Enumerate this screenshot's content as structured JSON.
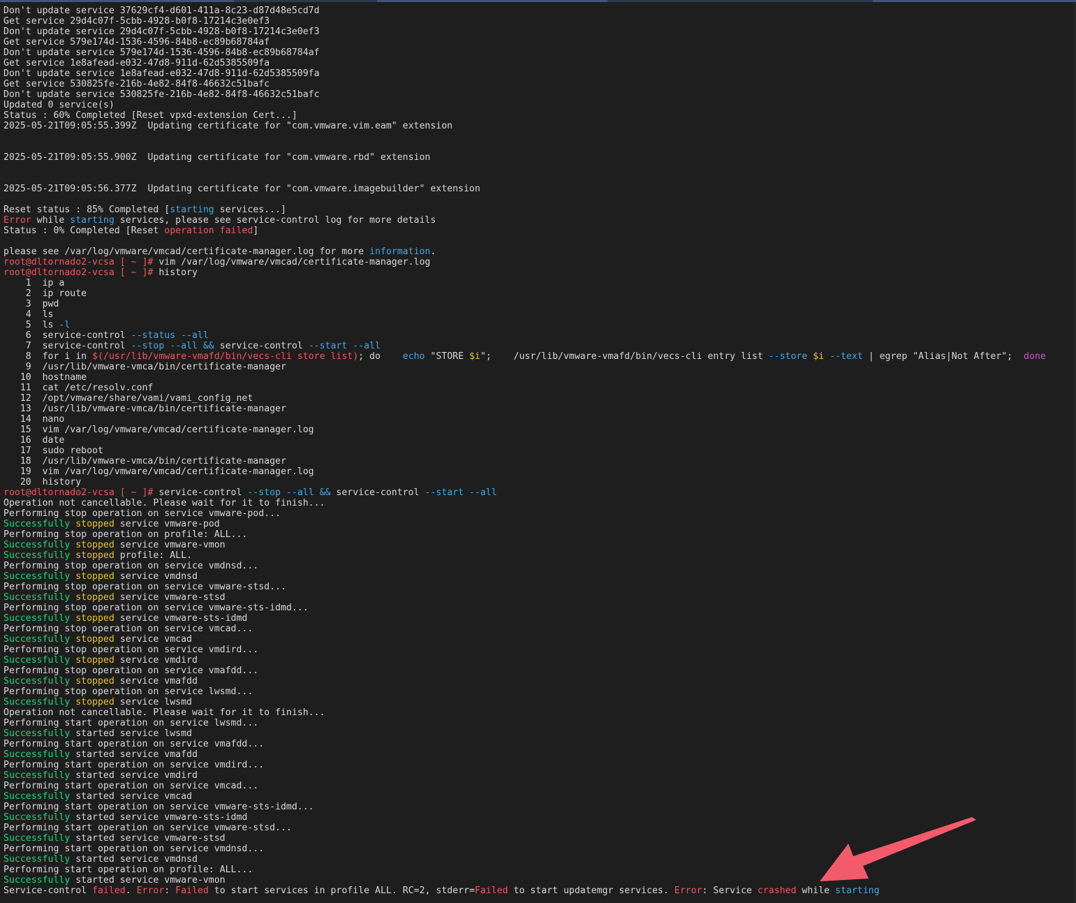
{
  "terminal": {
    "lines": [
      [
        {
          "t": "Don't update service 37629cf4-d601-411a-8c23-d87d48e5cd7d",
          "c": "normal"
        }
      ],
      [
        {
          "t": "Get service 29d4c07f-5cbb-4928-b0f8-17214c3e0ef3",
          "c": "normal"
        }
      ],
      [
        {
          "t": "Don't update service 29d4c07f-5cbb-4928-b0f8-17214c3e0ef3",
          "c": "normal"
        }
      ],
      [
        {
          "t": "Get service 579e174d-1536-4596-84b8-ec89b68784af",
          "c": "normal"
        }
      ],
      [
        {
          "t": "Don't update service 579e174d-1536-4596-84b8-ec89b68784af",
          "c": "normal"
        }
      ],
      [
        {
          "t": "Get service 1e8afead-e032-47d8-911d-62d5385509fa",
          "c": "normal"
        }
      ],
      [
        {
          "t": "Don't update service 1e8afead-e032-47d8-911d-62d5385509fa",
          "c": "normal"
        }
      ],
      [
        {
          "t": "Get service 530825fe-216b-4e82-84f8-46632c51bafc",
          "c": "normal"
        }
      ],
      [
        {
          "t": "Don't update service 530825fe-216b-4e82-84f8-46632c51bafc",
          "c": "normal"
        }
      ],
      [
        {
          "t": "Updated 0 service(s)",
          "c": "normal"
        }
      ],
      [
        {
          "t": "Status : 60% Completed [Reset vpxd-extension Cert...]",
          "c": "normal"
        }
      ],
      [
        {
          "t": "2025-05-21T09:05:55.399Z  Updating certificate for \"com.vmware.vim.eam\" extension",
          "c": "normal"
        }
      ],
      [],
      [],
      [
        {
          "t": "2025-05-21T09:05:55.900Z  Updating certificate for \"com.vmware.rbd\" extension",
          "c": "normal"
        }
      ],
      [],
      [],
      [
        {
          "t": "2025-05-21T09:05:56.377Z  Updating certificate for \"com.vmware.imagebuilder\" extension",
          "c": "normal"
        }
      ],
      [],
      [
        {
          "t": "Reset status : 85% Completed [",
          "c": "normal"
        },
        {
          "t": "starting",
          "c": "cyan"
        },
        {
          "t": " services...]",
          "c": "normal"
        }
      ],
      [
        {
          "t": "Error",
          "c": "red"
        },
        {
          "t": " while ",
          "c": "normal"
        },
        {
          "t": "starting",
          "c": "cyan"
        },
        {
          "t": " services, please see service-control log for more details",
          "c": "normal"
        }
      ],
      [
        {
          "t": "Status : 0% Completed [Reset ",
          "c": "normal"
        },
        {
          "t": "operation failed",
          "c": "red"
        },
        {
          "t": "]",
          "c": "normal"
        }
      ],
      [],
      [
        {
          "t": "please see /var/log/vmware/vmcad/certificate-manager.log for more ",
          "c": "normal"
        },
        {
          "t": "information",
          "c": "cyan"
        },
        {
          "t": ".",
          "c": "normal"
        }
      ],
      [
        {
          "t": "root@dltornado2-vcsa [ ~ ]#",
          "c": "prompt"
        },
        {
          "t": " vim /var/log/vmware/vmcad/certificate-manager.log",
          "c": "normal"
        }
      ],
      [
        {
          "t": "root@dltornado2-vcsa [ ~ ]#",
          "c": "prompt"
        },
        {
          "t": " history",
          "c": "normal"
        }
      ],
      [
        {
          "t": "    1  ip a",
          "c": "normal"
        }
      ],
      [
        {
          "t": "    2  ip route",
          "c": "normal"
        }
      ],
      [
        {
          "t": "    3  pwd",
          "c": "normal"
        }
      ],
      [
        {
          "t": "    4  ls",
          "c": "normal"
        }
      ],
      [
        {
          "t": "    5  ls ",
          "c": "normal"
        },
        {
          "t": "-l",
          "c": "cyan"
        }
      ],
      [
        {
          "t": "    6  service-control ",
          "c": "normal"
        },
        {
          "t": "--status --all",
          "c": "cyan"
        }
      ],
      [
        {
          "t": "    7  service-control ",
          "c": "normal"
        },
        {
          "t": "--stop --all && ",
          "c": "cyan"
        },
        {
          "t": "service-control ",
          "c": "normal"
        },
        {
          "t": "--start --all",
          "c": "cyan"
        }
      ],
      [
        {
          "t": "    8  for i in ",
          "c": "normal"
        },
        {
          "t": "$(/usr/lib/vmware-vmafd/bin/vecs-cli store list)",
          "c": "red"
        },
        {
          "t": "; do    ",
          "c": "normal"
        },
        {
          "t": "echo",
          "c": "cyan"
        },
        {
          "t": " \"STORE ",
          "c": "normal"
        },
        {
          "t": "$i",
          "c": "yellow"
        },
        {
          "t": "\";    /usr/lib/vmware-vmafd/bin/vecs-cli entry list ",
          "c": "normal"
        },
        {
          "t": "--store",
          "c": "cyan"
        },
        {
          "t": " ",
          "c": "normal"
        },
        {
          "t": "$i",
          "c": "yellow"
        },
        {
          "t": " ",
          "c": "normal"
        },
        {
          "t": "--text",
          "c": "cyan"
        },
        {
          "t": " | egrep \"Alias|Not After\";  ",
          "c": "normal"
        },
        {
          "t": "done",
          "c": "magenta"
        }
      ],
      [
        {
          "t": "    9  /usr/lib/vmware-vmca/bin/certificate-manager",
          "c": "normal"
        }
      ],
      [
        {
          "t": "   10  hostname",
          "c": "normal"
        }
      ],
      [
        {
          "t": "   11  cat /etc/resolv.conf",
          "c": "normal"
        }
      ],
      [
        {
          "t": "   12  /opt/vmware/share/vami/vami_config_net",
          "c": "normal"
        }
      ],
      [
        {
          "t": "   13  /usr/lib/vmware-vmca/bin/certificate-manager",
          "c": "normal"
        }
      ],
      [
        {
          "t": "   14  nano",
          "c": "normal"
        }
      ],
      [
        {
          "t": "   15  vim /var/log/vmware/vmcad/certificate-manager.log",
          "c": "normal"
        }
      ],
      [
        {
          "t": "   16  date",
          "c": "normal"
        }
      ],
      [
        {
          "t": "   17  sudo reboot",
          "c": "normal"
        }
      ],
      [
        {
          "t": "   18  /usr/lib/vmware-vmca/bin/certificate-manager",
          "c": "normal"
        }
      ],
      [
        {
          "t": "   19  vim /var/log/vmware/vmcad/certificate-manager.log",
          "c": "normal"
        }
      ],
      [
        {
          "t": "   20  history",
          "c": "normal"
        }
      ],
      [
        {
          "t": "root@dltornado2-vcsa [ ~ ]#",
          "c": "prompt"
        },
        {
          "t": " service-control ",
          "c": "normal"
        },
        {
          "t": "--stop --all && ",
          "c": "cyan"
        },
        {
          "t": "service-control ",
          "c": "normal"
        },
        {
          "t": "--start --all",
          "c": "cyan"
        }
      ],
      [
        {
          "t": "Operation not cancellable. Please wait for it to finish...",
          "c": "normal"
        }
      ],
      [
        {
          "t": "Performing stop operation on service vmware-pod...",
          "c": "normal"
        }
      ],
      [
        {
          "t": "Successfully",
          "c": "green"
        },
        {
          "t": " ",
          "c": "normal"
        },
        {
          "t": "stopped",
          "c": "yellow"
        },
        {
          "t": " service vmware-pod",
          "c": "normal"
        }
      ],
      [
        {
          "t": "Performing stop operation on profile: ALL...",
          "c": "normal"
        }
      ],
      [
        {
          "t": "Successfully",
          "c": "green"
        },
        {
          "t": " ",
          "c": "normal"
        },
        {
          "t": "stopped",
          "c": "yellow"
        },
        {
          "t": " service vmware-vmon",
          "c": "normal"
        }
      ],
      [
        {
          "t": "Successfully",
          "c": "green"
        },
        {
          "t": " ",
          "c": "normal"
        },
        {
          "t": "stopped",
          "c": "yellow"
        },
        {
          "t": " profile: ALL.",
          "c": "normal"
        }
      ],
      [
        {
          "t": "Performing stop operation on service vmdnsd...",
          "c": "normal"
        }
      ],
      [
        {
          "t": "Successfully",
          "c": "green"
        },
        {
          "t": " ",
          "c": "normal"
        },
        {
          "t": "stopped",
          "c": "yellow"
        },
        {
          "t": " service vmdnsd",
          "c": "normal"
        }
      ],
      [
        {
          "t": "Performing stop operation on service vmware-stsd...",
          "c": "normal"
        }
      ],
      [
        {
          "t": "Successfully",
          "c": "green"
        },
        {
          "t": " ",
          "c": "normal"
        },
        {
          "t": "stopped",
          "c": "yellow"
        },
        {
          "t": " service vmware-stsd",
          "c": "normal"
        }
      ],
      [
        {
          "t": "Performing stop operation on service vmware-sts-idmd...",
          "c": "normal"
        }
      ],
      [
        {
          "t": "Successfully",
          "c": "green"
        },
        {
          "t": " ",
          "c": "normal"
        },
        {
          "t": "stopped",
          "c": "yellow"
        },
        {
          "t": " service vmware-sts-idmd",
          "c": "normal"
        }
      ],
      [
        {
          "t": "Performing stop operation on service vmcad...",
          "c": "normal"
        }
      ],
      [
        {
          "t": "Successfully",
          "c": "green"
        },
        {
          "t": " ",
          "c": "normal"
        },
        {
          "t": "stopped",
          "c": "yellow"
        },
        {
          "t": " service vmcad",
          "c": "normal"
        }
      ],
      [
        {
          "t": "Performing stop operation on service vmdird...",
          "c": "normal"
        }
      ],
      [
        {
          "t": "Successfully",
          "c": "green"
        },
        {
          "t": " ",
          "c": "normal"
        },
        {
          "t": "stopped",
          "c": "yellow"
        },
        {
          "t": " service vmdird",
          "c": "normal"
        }
      ],
      [
        {
          "t": "Performing stop operation on service vmafdd...",
          "c": "normal"
        }
      ],
      [
        {
          "t": "Successfully",
          "c": "green"
        },
        {
          "t": " ",
          "c": "normal"
        },
        {
          "t": "stopped",
          "c": "yellow"
        },
        {
          "t": " service vmafdd",
          "c": "normal"
        }
      ],
      [
        {
          "t": "Performing stop operation on service lwsmd...",
          "c": "normal"
        }
      ],
      [
        {
          "t": "Successfully",
          "c": "green"
        },
        {
          "t": " ",
          "c": "normal"
        },
        {
          "t": "stopped",
          "c": "yellow"
        },
        {
          "t": " service lwsmd",
          "c": "normal"
        }
      ],
      [
        {
          "t": "Operation not cancellable. Please wait for it to finish...",
          "c": "normal"
        }
      ],
      [
        {
          "t": "Performing start operation on service lwsmd...",
          "c": "normal"
        }
      ],
      [
        {
          "t": "Successfully",
          "c": "green"
        },
        {
          "t": " started service lwsmd",
          "c": "normal"
        }
      ],
      [
        {
          "t": "Performing start operation on service vmafdd...",
          "c": "normal"
        }
      ],
      [
        {
          "t": "Successfully",
          "c": "green"
        },
        {
          "t": " started service vmafdd",
          "c": "normal"
        }
      ],
      [
        {
          "t": "Performing start operation on service vmdird...",
          "c": "normal"
        }
      ],
      [
        {
          "t": "Successfully",
          "c": "green"
        },
        {
          "t": " started service vmdird",
          "c": "normal"
        }
      ],
      [
        {
          "t": "Performing start operation on service vmcad...",
          "c": "normal"
        }
      ],
      [
        {
          "t": "Successfully",
          "c": "green"
        },
        {
          "t": " started service vmcad",
          "c": "normal"
        }
      ],
      [
        {
          "t": "Performing start operation on service vmware-sts-idmd...",
          "c": "normal"
        }
      ],
      [
        {
          "t": "Successfully",
          "c": "green"
        },
        {
          "t": " started service vmware-sts-idmd",
          "c": "normal"
        }
      ],
      [
        {
          "t": "Performing start operation on service vmware-stsd...",
          "c": "normal"
        }
      ],
      [
        {
          "t": "Successfully",
          "c": "green"
        },
        {
          "t": " started service vmware-stsd",
          "c": "normal"
        }
      ],
      [
        {
          "t": "Performing start operation on service vmdnsd...",
          "c": "normal"
        }
      ],
      [
        {
          "t": "Successfully",
          "c": "green"
        },
        {
          "t": " started service vmdnsd",
          "c": "normal"
        }
      ],
      [
        {
          "t": "Performing start operation on profile: ALL...",
          "c": "normal"
        }
      ],
      [
        {
          "t": "Successfully",
          "c": "green"
        },
        {
          "t": " started service vmware-vmon",
          "c": "normal"
        }
      ],
      [
        {
          "t": "Service-control ",
          "c": "normal"
        },
        {
          "t": "failed",
          "c": "red"
        },
        {
          "t": ". ",
          "c": "normal"
        },
        {
          "t": "Error",
          "c": "red"
        },
        {
          "t": ": ",
          "c": "normal"
        },
        {
          "t": "Failed",
          "c": "red"
        },
        {
          "t": " to start services in profile ALL. RC=2, stderr=",
          "c": "normal"
        },
        {
          "t": "Failed",
          "c": "red"
        },
        {
          "t": " to start updatemgr services. ",
          "c": "normal"
        },
        {
          "t": "Error",
          "c": "red"
        },
        {
          "t": ": Service ",
          "c": "normal"
        },
        {
          "t": "crashed",
          "c": "red"
        },
        {
          "t": " while ",
          "c": "normal"
        },
        {
          "t": "starting",
          "c": "cyan"
        }
      ]
    ]
  },
  "colors": {
    "background": "#1e1e1e",
    "text": "#d8d8d8",
    "red": "#f0565e",
    "cyan": "#3fa9e6",
    "green": "#20d77a",
    "yellow": "#e8c232",
    "magenta": "#d14fd8",
    "annotation_arrow": "#f35b6b"
  }
}
